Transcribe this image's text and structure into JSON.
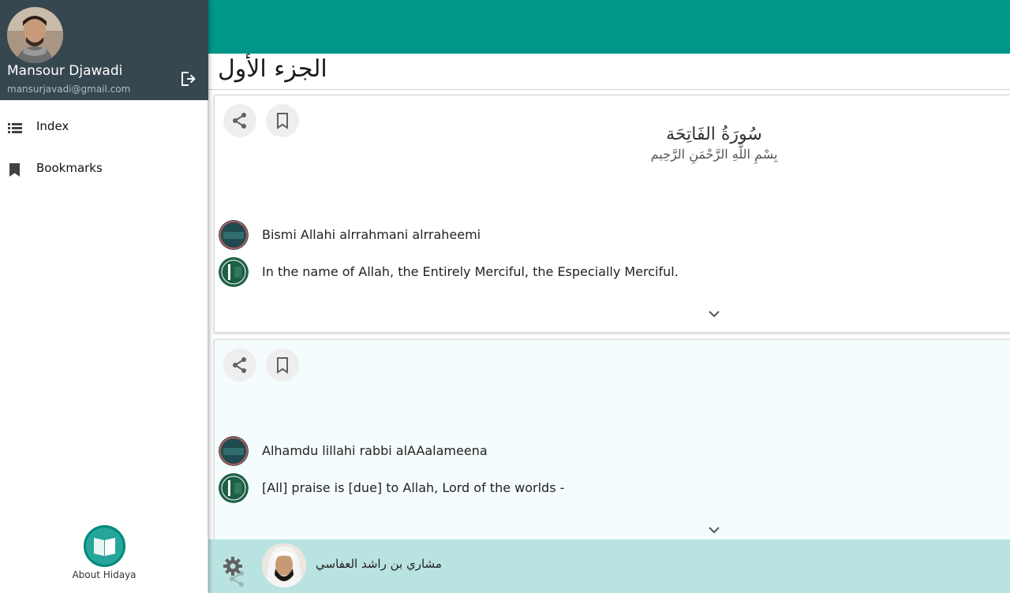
{
  "user": {
    "name": "Mansour Djawadi",
    "email": "mansurjavadi@gmail.com"
  },
  "nav": {
    "items": [
      {
        "label": "Index",
        "icon": "list-icon"
      },
      {
        "label": "Bookmarks",
        "icon": "bookmark-icon"
      }
    ],
    "about_label": "About Hidaya"
  },
  "header": {
    "juz_title": "الجزء الأول"
  },
  "cards": [
    {
      "surah_name": "سُورَةُ الفَاتِحَة",
      "basmala": "بِسْمِ اللَّهِ الرَّحْمَنِ الرَّحِيم",
      "transliteration": "Bismi Allahi alrrahmani alrraheemi",
      "translation": "In the name of Allah, the Entirely Merciful, the Especially Merciful."
    },
    {
      "transliteration": "Alhamdu lillahi rabbi alAAalameena",
      "translation": "[All] praise is [due] to Allah, Lord of the worlds -"
    }
  ],
  "player": {
    "reciter_name": "مشاري بن راشد العفاسي"
  },
  "colors": {
    "primary": "#009688",
    "profile_bg": "#37474f",
    "player_bg": "#b9e3e0",
    "card2_bg": "#f4fcfd"
  }
}
